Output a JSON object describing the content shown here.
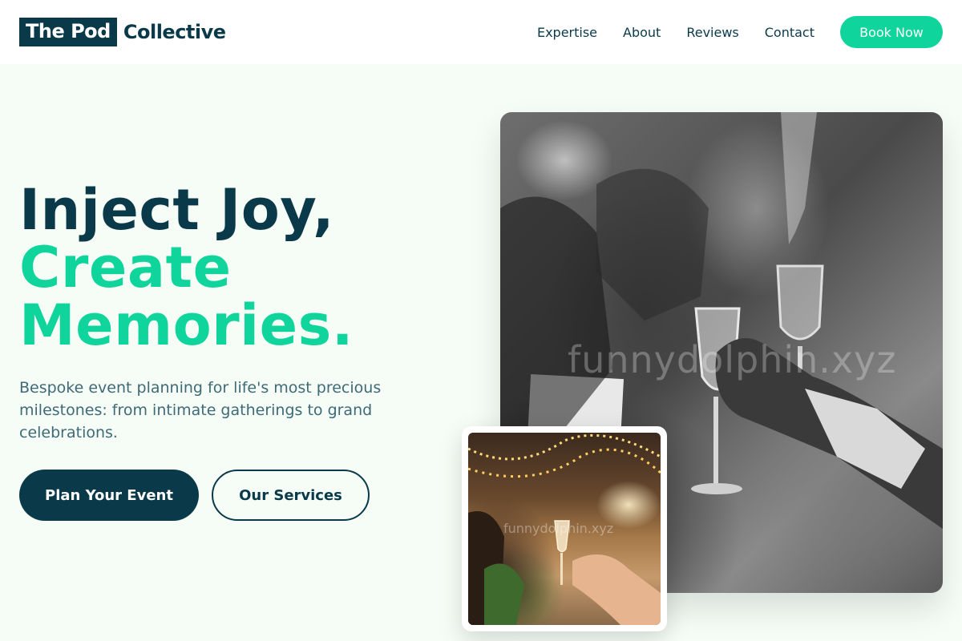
{
  "brand": {
    "logo_box": "The Pod",
    "logo_rest": "Collective"
  },
  "nav": {
    "links": [
      "Expertise",
      "About",
      "Reviews",
      "Contact"
    ],
    "cta": "Book Now"
  },
  "hero": {
    "title_line1": "Inject Joy,",
    "title_line2": "Create",
    "title_line3": "Memories.",
    "subtitle": "Bespoke event planning for life's most precious milestones: from intimate gatherings to grand celebrations.",
    "primary_button": "Plan Your Event",
    "secondary_button": "Our Services"
  },
  "images": {
    "main_watermark": "funnydolphin.xyz",
    "small_watermark": "funnydolphin.xyz"
  },
  "colors": {
    "primary": "#0a3a4a",
    "accent": "#0fd49b",
    "background": "#f5fdf6",
    "muted_text": "#3e6a78"
  }
}
